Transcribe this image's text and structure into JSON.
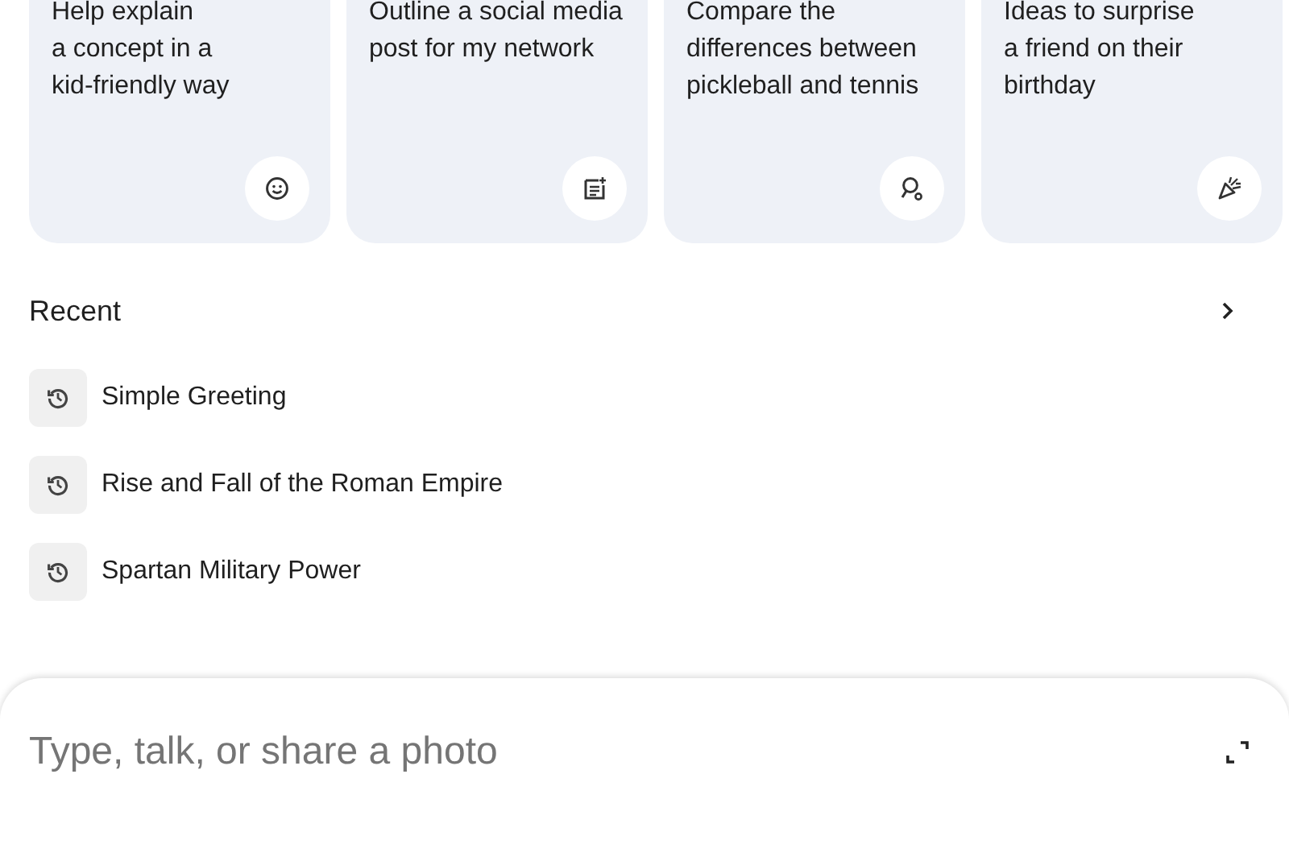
{
  "suggestion_cards": [
    {
      "lines": [
        "Help explain",
        "a concept in a",
        "kid-friendly way"
      ]
    },
    {
      "lines": [
        "Outline a social media",
        "post for my network"
      ]
    },
    {
      "lines": [
        "Compare the",
        "differences between",
        "pickleball and tennis"
      ]
    },
    {
      "lines": [
        "Ideas to surprise",
        "a friend on their",
        "birthday"
      ]
    }
  ],
  "recent": {
    "title": "Recent",
    "items": [
      {
        "label": "Simple Greeting"
      },
      {
        "label": "Rise and Fall of the Roman Empire"
      },
      {
        "label": "Spartan Military Power"
      }
    ]
  },
  "prompt_input": {
    "placeholder": "Type, talk, or share a photo"
  }
}
